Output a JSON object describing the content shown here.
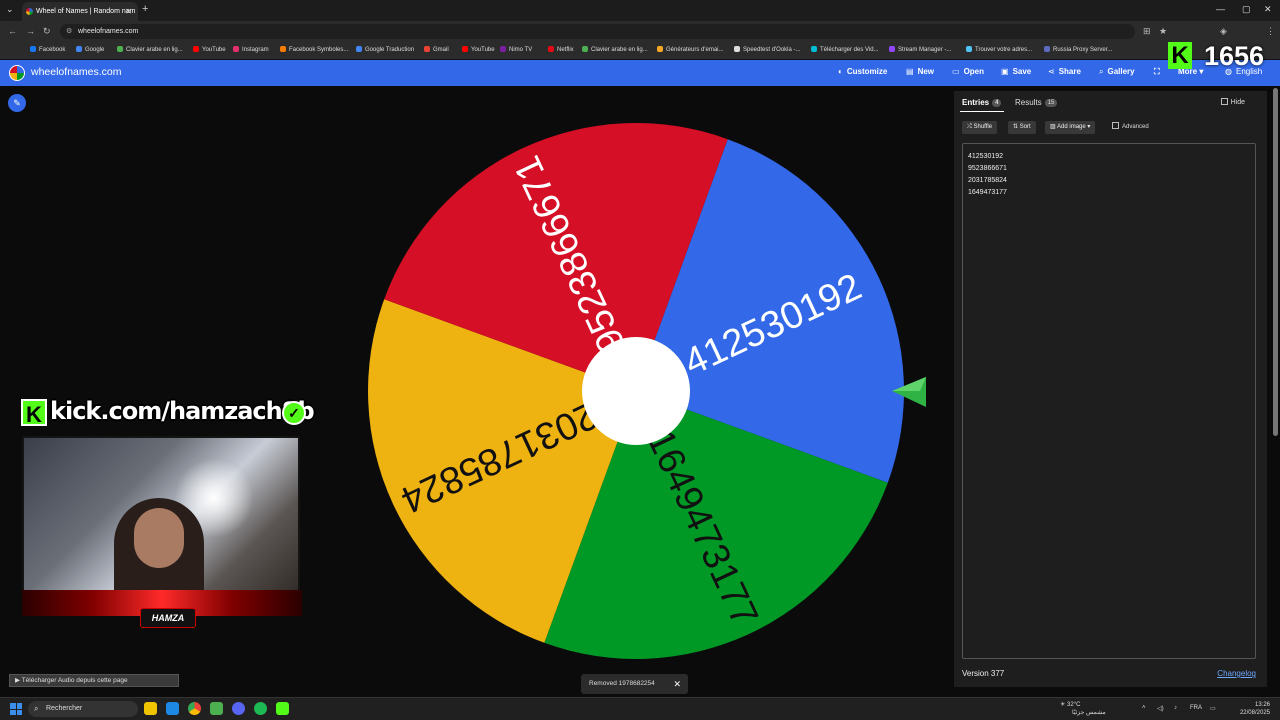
{
  "browser": {
    "tab_title": "Wheel of Names | Random nam",
    "url": "wheelofnames.com",
    "bookmarks": [
      "Facebook",
      "Google",
      "Clavier arabe en lig...",
      "YouTube",
      "Instagram",
      "Facebook Symboles...",
      "Google Traduction",
      "Gmail",
      "YouTube",
      "Nimo TV",
      "Netflix",
      "Clavier arabe en lig...",
      "Générateurs d'emai...",
      "Speedtest d'Ookla -...",
      "Télécharger des Vid...",
      "Stream Manager -...",
      "Trouver votre adres...",
      "Russia Proxy Server..."
    ],
    "bookmark_colors": [
      "#1877f2",
      "#4285f4",
      "#4caf50",
      "#ff0000",
      "#e1306c",
      "#f57c00",
      "#4285f4",
      "#ea4335",
      "#ff0000",
      "#7b1fa2",
      "#e50914",
      "#4caf50",
      "#f9a825",
      "#ddd",
      "#00bcd4",
      "#9146ff",
      "#4fc3f7",
      "#5c6bc0"
    ]
  },
  "header": {
    "site_name": "wheelofnames.com",
    "buttons": [
      "Customize",
      "New",
      "Open",
      "Save",
      "Share",
      "Gallery",
      "More",
      "English"
    ]
  },
  "wheel": {
    "segments": [
      {
        "label": "412530192",
        "color": "#3369e8"
      },
      {
        "label": "1649473177",
        "color": "#009925"
      },
      {
        "label": "2031785824",
        "color": "#eeb211"
      },
      {
        "label": "9523866671",
        "color": "#d50f25"
      }
    ]
  },
  "panel": {
    "tab_entries": "Entries",
    "entries_count": "4",
    "tab_results": "Results",
    "results_count": "15",
    "hide_label": "Hide",
    "shuffle_label": "Shuffle",
    "sort_label": "Sort",
    "add_image_label": "Add image",
    "advanced_label": "Advanced",
    "entries": [
      "412530192",
      "9523866671",
      "2031785824",
      "1649473177"
    ],
    "version": "Version 377",
    "changelog": "Changelog"
  },
  "overlay": {
    "viewer_count": "1656",
    "kick_url": "kick.com/hamzach8b",
    "kick_letter": "K",
    "streamer_tag": "HAMZA",
    "audio_button": "Télécharger Audio depuis cette page"
  },
  "toast": {
    "text": "Removed 1978682254"
  },
  "taskbar": {
    "search_placeholder": "Rechercher",
    "temperature": "32°C",
    "weather_text": "مشمس جزئيًا",
    "language": "FRA",
    "time": "13:26",
    "date": "22/08/2025"
  }
}
